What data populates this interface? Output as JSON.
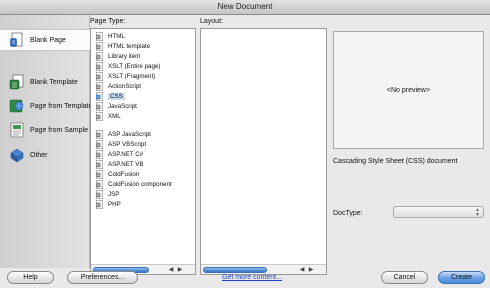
{
  "window": {
    "title": "New Document"
  },
  "sidebar": {
    "items": [
      {
        "label": "Blank Page",
        "selected": true,
        "icon": "blank-page-icon"
      },
      {
        "label": "Blank Template",
        "selected": false,
        "icon": "blank-template-icon"
      },
      {
        "label": "Page from Template",
        "selected": false,
        "icon": "page-from-template-icon"
      },
      {
        "label": "Page from Sample",
        "selected": false,
        "icon": "page-from-sample-icon"
      },
      {
        "label": "Other",
        "selected": false,
        "icon": "other-icon"
      }
    ]
  },
  "page_type": {
    "label": "Page Type:",
    "items": [
      {
        "label": "HTML"
      },
      {
        "label": "HTML template"
      },
      {
        "label": "Library item"
      },
      {
        "label": "XSLT (Entire page)"
      },
      {
        "label": "XSLT (Fragment)"
      },
      {
        "label": "ActionScript"
      },
      {
        "label": "CSS",
        "selected": true
      },
      {
        "label": "JavaScript"
      },
      {
        "label": "XML"
      },
      {
        "label": "ASP JavaScript"
      },
      {
        "label": "ASP VBScript"
      },
      {
        "label": "ASP.NET C#"
      },
      {
        "label": "ASP.NET VB"
      },
      {
        "label": "ColdFusion"
      },
      {
        "label": "ColdFusion component"
      },
      {
        "label": "JSP"
      },
      {
        "label": "PHP"
      }
    ]
  },
  "layout": {
    "label": "Layout:"
  },
  "preview": {
    "text": "<No preview>"
  },
  "description": "Cascading Style Sheet (CSS) document",
  "doctype": {
    "label": "DocType:",
    "value": ""
  },
  "buttons": {
    "help": "Help",
    "preferences": "Preferences...",
    "get_more": "Get more content...",
    "cancel": "Cancel",
    "create": "Create"
  },
  "colors": {
    "accent": "#4a8ddd",
    "link": "#1f3fcf",
    "selection": "#c8d8ef"
  }
}
